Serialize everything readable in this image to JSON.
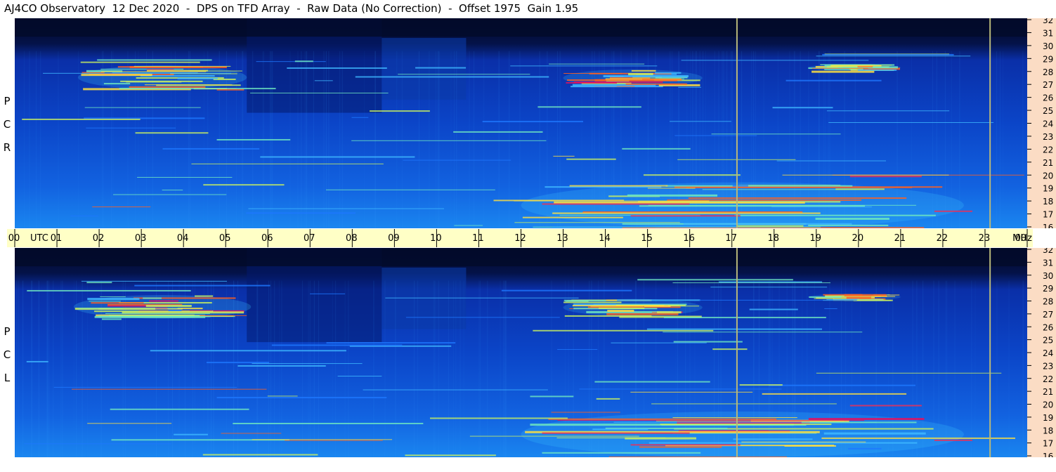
{
  "title": "AJ4CO Observatory  12 Dec 2020  -  DPS on TFD Array  -  Raw Data (No Correction)  -  Offset 1975  Gain 1.95",
  "colors": {
    "background": "#0a1f5c",
    "time_axis_bg": "#ffffc6",
    "freq_axis_bg": "#fbdcc4",
    "marker_line": "#b8b87a",
    "colormap": [
      "#020a2a",
      "#061a6a",
      "#0a3fd0",
      "#1e78ff",
      "#3fb8ff",
      "#6fe8c0",
      "#c8f060",
      "#ffe040",
      "#ff6020",
      "#e01060"
    ]
  },
  "chart_data": [
    {
      "type": "heatmap",
      "panel": "RCP",
      "side_label": [
        "R",
        "C",
        "P"
      ],
      "x_unit": "UTC",
      "y_unit": "MHz",
      "x_ticks": [
        "00",
        "01",
        "02",
        "03",
        "04",
        "05",
        "06",
        "07",
        "08",
        "09",
        "10",
        "11",
        "12",
        "13",
        "14",
        "15",
        "16",
        "17",
        "18",
        "19",
        "20",
        "21",
        "22",
        "23",
        "00"
      ],
      "y_ticks": [
        "16",
        "17",
        "18",
        "19",
        "20",
        "21",
        "22",
        "23",
        "24",
        "25",
        "26",
        "27",
        "28",
        "29",
        "30",
        "31",
        "32"
      ],
      "xlim": [
        0,
        24
      ],
      "ylim": [
        16,
        32
      ],
      "markers_utc": [
        17.12,
        23.12
      ],
      "features": [
        {
          "kind": "emission",
          "t_start": 1.5,
          "t_end": 5.5,
          "f_low": 26.6,
          "f_high": 28.4,
          "intensity": 0.55
        },
        {
          "kind": "emission",
          "t_start": 13.0,
          "t_end": 16.3,
          "f_low": 26.8,
          "f_high": 28.1,
          "intensity": 0.45
        },
        {
          "kind": "emission",
          "t_start": 18.8,
          "t_end": 21.0,
          "f_low": 28.0,
          "f_high": 28.5,
          "intensity": 0.35
        },
        {
          "kind": "emission",
          "t_start": 12.0,
          "t_end": 22.5,
          "f_low": 16.0,
          "f_high": 19.5,
          "intensity": 0.5
        }
      ]
    },
    {
      "type": "heatmap",
      "panel": "LCP",
      "side_label": [
        "L",
        "C",
        "P"
      ],
      "x_unit": "UTC",
      "y_unit": "MHz",
      "x_ticks": [
        "00",
        "01",
        "02",
        "03",
        "04",
        "05",
        "06",
        "07",
        "08",
        "09",
        "10",
        "11",
        "12",
        "13",
        "14",
        "15",
        "16",
        "17",
        "18",
        "19",
        "20",
        "21",
        "22",
        "23",
        "00"
      ],
      "y_ticks": [
        "16",
        "17",
        "18",
        "19",
        "20",
        "21",
        "22",
        "23",
        "24",
        "25",
        "26",
        "27",
        "28",
        "29",
        "30",
        "31",
        "32"
      ],
      "xlim": [
        0,
        24
      ],
      "ylim": [
        16,
        32
      ],
      "markers_utc": [
        17.12,
        23.12
      ],
      "features": [
        {
          "kind": "emission",
          "t_start": 1.4,
          "t_end": 5.6,
          "f_low": 26.6,
          "f_high": 28.4,
          "intensity": 0.55
        },
        {
          "kind": "emission",
          "t_start": 13.0,
          "t_end": 16.3,
          "f_low": 26.8,
          "f_high": 28.1,
          "intensity": 0.45
        },
        {
          "kind": "emission",
          "t_start": 18.8,
          "t_end": 21.0,
          "f_low": 28.0,
          "f_high": 28.5,
          "intensity": 0.3
        },
        {
          "kind": "emission",
          "t_start": 12.0,
          "t_end": 22.5,
          "f_low": 16.0,
          "f_high": 19.5,
          "intensity": 0.5
        }
      ]
    }
  ],
  "time_axis": {
    "utc_label": "UTC",
    "mhz_label": "MHz"
  }
}
